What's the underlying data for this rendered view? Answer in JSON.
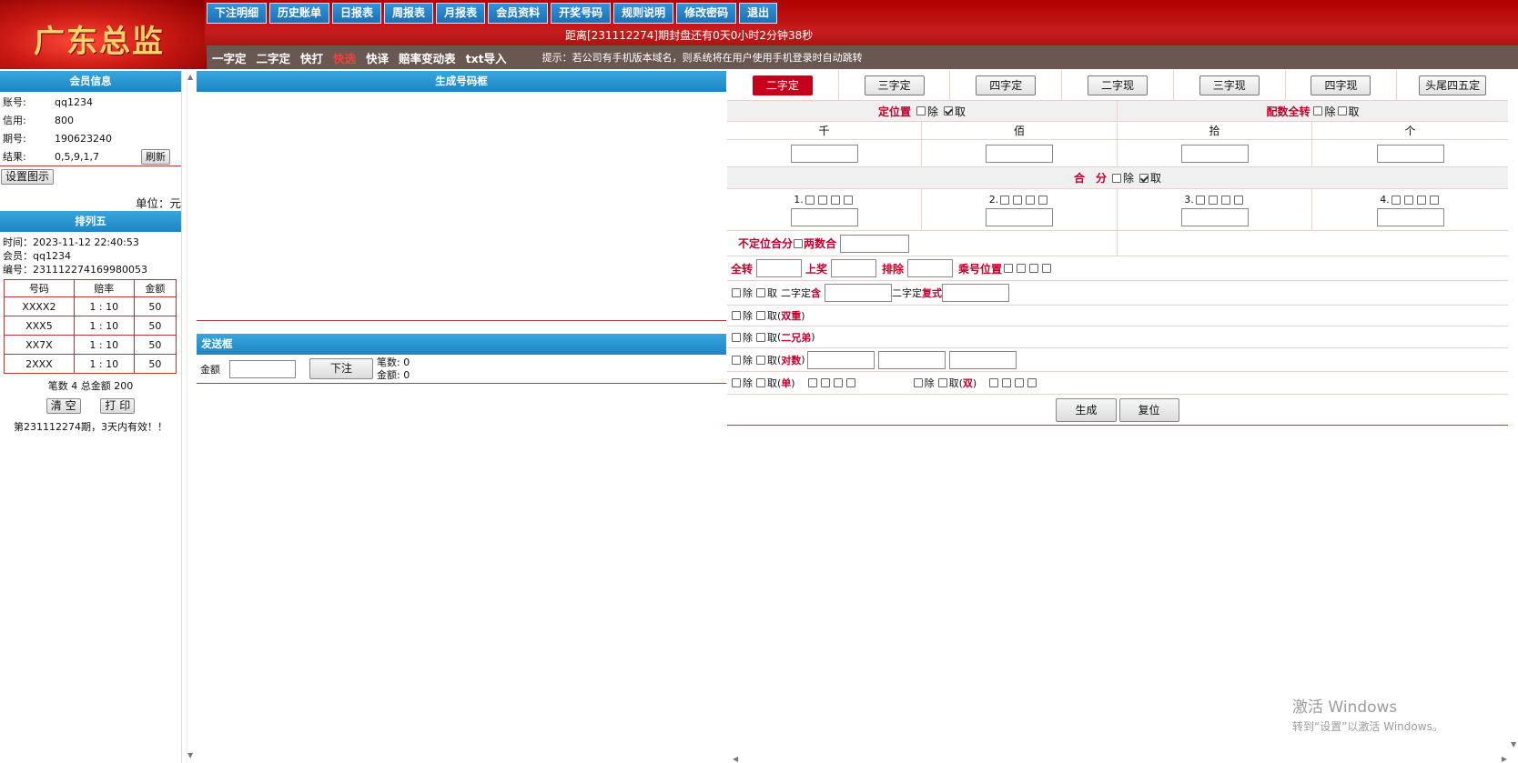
{
  "header": {
    "logo": "广东总监",
    "nav": [
      "下注明细",
      "历史账单",
      "日报表",
      "周报表",
      "月报表",
      "会员资料",
      "开奖号码",
      "规则说明",
      "修改密码",
      "退出"
    ],
    "countdown": "距离[231112274]期封盘还有0天0小时2分钟38秒",
    "subnav": [
      "一字定",
      "二字定",
      "快打",
      "快选",
      "快译",
      "赔率变动表",
      "txt导入"
    ],
    "subnav_active": "快选",
    "tip": "提示：若公司有手机版本域名，则系统将在用户使用手机登录时自动跳转"
  },
  "member": {
    "title": "会员信息",
    "rows": [
      {
        "k": "账号:",
        "v": "qq1234"
      },
      {
        "k": "信用:",
        "v": "800"
      },
      {
        "k": "期号:",
        "v": "190623240"
      },
      {
        "k": "结果:",
        "v": "0,5,9,1,7"
      }
    ],
    "refresh": "刷新",
    "setting": "设置图示",
    "unit": "单位：元"
  },
  "pailie": {
    "title": "排列五",
    "time": "时间：2023-11-12 22:40:53",
    "member": "会员：qq1234",
    "serial": "编号：231112274169980053",
    "table": {
      "headers": [
        "号码",
        "赔率",
        "金额"
      ],
      "rows": [
        [
          "XXXX2",
          "1 : 10",
          "50"
        ],
        [
          "XXX5",
          "1 : 10",
          "50"
        ],
        [
          "XX7X",
          "1 : 10",
          "50"
        ],
        [
          "2XXX",
          "1 : 10",
          "50"
        ]
      ]
    },
    "summary": "笔数 4 总金额 200",
    "clear": "清 空",
    "print": "打 印",
    "valid": "第231112274期，3天内有效！！"
  },
  "middle": {
    "gen_title": "生成号码框",
    "send_title": "发送框",
    "amount_label": "金额",
    "submit": "下注",
    "count": "笔数: 0",
    "total": "金额: 0"
  },
  "right": {
    "tabs": [
      "二字定",
      "三字定",
      "四字定",
      "二字现",
      "三字现",
      "四字现",
      "头尾四五定"
    ],
    "active_tab": "二字定",
    "dingweizhi": "定位置",
    "peishu": "配数全转",
    "chu": "除",
    "qu": "取",
    "positions": [
      "千",
      "佰",
      "拾",
      "个"
    ],
    "hefen": "合　分",
    "hefen_nums": [
      "1.",
      "2.",
      "3.",
      "4."
    ],
    "budingwei": "不定位合分",
    "liangshuhe": "两数合",
    "quanzhuan": "全转",
    "shangjiang": "上奖",
    "paichu": "排除",
    "chenghao": "乘号位置",
    "erzi_han_prefix": "二字定",
    "han": "含",
    "erzi_fushi_prefix": "二字定",
    "fushi": "复式",
    "shuangchong": "双重",
    "erxiongdi": "二兄弟",
    "duishu": "对数",
    "dan": "单",
    "shuang": "双",
    "generate": "生成",
    "reset": "复位"
  },
  "watermark": {
    "line1": "激活 Windows",
    "line2": "转到“设置”以激活 Windows。"
  }
}
